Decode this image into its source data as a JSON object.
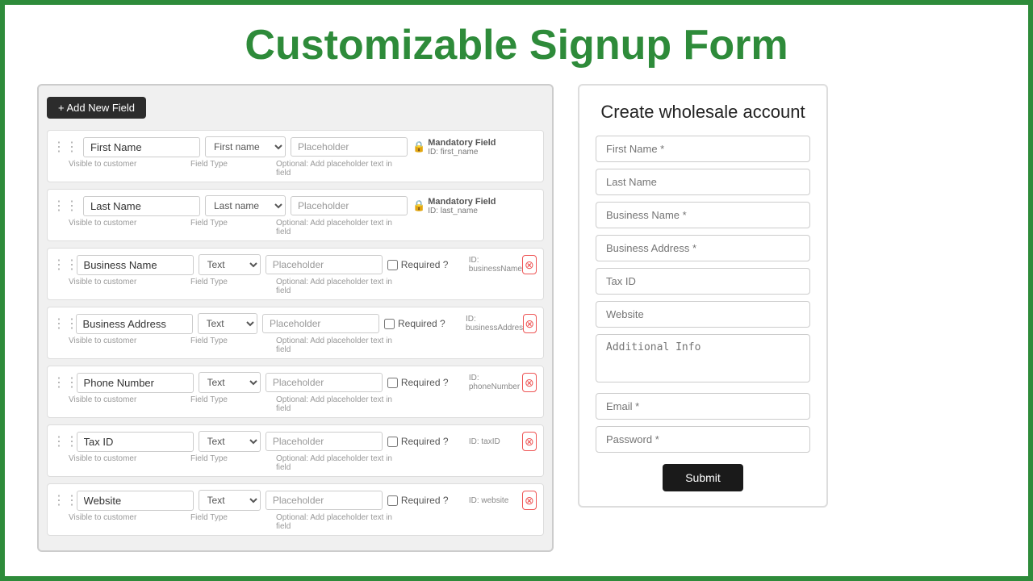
{
  "page": {
    "title": "Customizable Signup Form",
    "border_color": "#2e8b3a"
  },
  "left_panel": {
    "add_button_label": "+ Add New Field",
    "fields": [
      {
        "name": "First Name",
        "type": "First name",
        "placeholder": "Placeholder",
        "visible_label": "Visible to customer",
        "field_type_label": "Field Type",
        "placeholder_label": "Optional: Add placeholder text in field",
        "badge": "Mandatory Field",
        "id": "ID: first_name",
        "is_mandatory": true
      },
      {
        "name": "Last Name",
        "type": "Last name",
        "placeholder": "Placeholder",
        "visible_label": "Visible to customer",
        "field_type_label": "Field Type",
        "placeholder_label": "Optional: Add placeholder text in field",
        "badge": "Mandatory Field",
        "id": "ID: last_name",
        "is_mandatory": true
      },
      {
        "name": "Business Name",
        "type": "Text",
        "placeholder": "Placeholder",
        "visible_label": "Visible to customer",
        "field_type_label": "Field Type",
        "placeholder_label": "Optional: Add placeholder text in field",
        "required_label": "Required ?",
        "id": "ID: businessName",
        "is_mandatory": false
      },
      {
        "name": "Business Address",
        "type": "Text",
        "placeholder": "Placeholder",
        "visible_label": "Visible to customer",
        "field_type_label": "Field Type",
        "placeholder_label": "Optional: Add placeholder text in field",
        "required_label": "Required ?",
        "id": "ID: businessAddress",
        "is_mandatory": false
      },
      {
        "name": "Phone Number",
        "type": "Text",
        "placeholder": "Placeholder",
        "visible_label": "Visible to customer",
        "field_type_label": "Field Type",
        "placeholder_label": "Optional: Add placeholder text in field",
        "required_label": "Required ?",
        "id": "ID: phoneNumber",
        "is_mandatory": false
      },
      {
        "name": "Tax ID",
        "type": "Text",
        "placeholder": "Placeholder",
        "visible_label": "Visible to customer",
        "field_type_label": "Field Type",
        "placeholder_label": "Optional: Add placeholder text in field",
        "required_label": "Required ?",
        "id": "ID: taxID",
        "is_mandatory": false
      },
      {
        "name": "Website",
        "type": "Text",
        "placeholder": "Placeholder",
        "visible_label": "Visible to customer",
        "field_type_label": "Field Type",
        "placeholder_label": "Optional: Add placeholder text in field",
        "required_label": "Required ?",
        "id": "ID: website",
        "is_mandatory": false
      }
    ]
  },
  "right_panel": {
    "title": "Create wholesale account",
    "fields": [
      {
        "placeholder": "First Name *",
        "type": "text"
      },
      {
        "placeholder": "Last Name",
        "type": "text"
      },
      {
        "placeholder": "Business Name *",
        "type": "text"
      },
      {
        "placeholder": "Business Address *",
        "type": "text"
      },
      {
        "placeholder": "Tax ID",
        "type": "text"
      },
      {
        "placeholder": "Website",
        "type": "text"
      },
      {
        "placeholder": "Additional Info",
        "type": "textarea"
      },
      {
        "placeholder": "Email *",
        "type": "text"
      },
      {
        "placeholder": "Password *",
        "type": "text"
      }
    ],
    "submit_label": "Submit"
  }
}
